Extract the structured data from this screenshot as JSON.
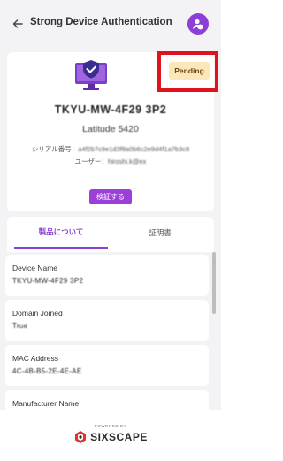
{
  "header": {
    "title": "Strong Device Authentication",
    "back_icon": "arrow-left-icon",
    "avatar_icon": "user-shield-icon",
    "accent_color": "#8b3fd6"
  },
  "device": {
    "status": "Pending",
    "name": "TKYU-MW-4F29 3P2",
    "model": "Latitude 5420",
    "serial_label": "シリアル番号：",
    "serial_value": "a4f2b7c9e1d3f8a0b6c2e9d4f1a7b3c8",
    "user_label": "ユーザー：",
    "user_value": "hiroshi.k@ex",
    "verify_label": "検証する"
  },
  "tabs": {
    "about": "製品について",
    "certificate": "証明書"
  },
  "details": [
    {
      "label": "Device Name",
      "value": "TKYU-MW-4F29 3P2"
    },
    {
      "label": "Domain Joined",
      "value": "True"
    },
    {
      "label": "MAC Address",
      "value": "4C-4B-B5-2E-4E-AE"
    },
    {
      "label": "Manufacturer Name",
      "value": ""
    }
  ],
  "footer": {
    "powered_by": "POWERED BY",
    "brand": "SIXSCAPE"
  }
}
